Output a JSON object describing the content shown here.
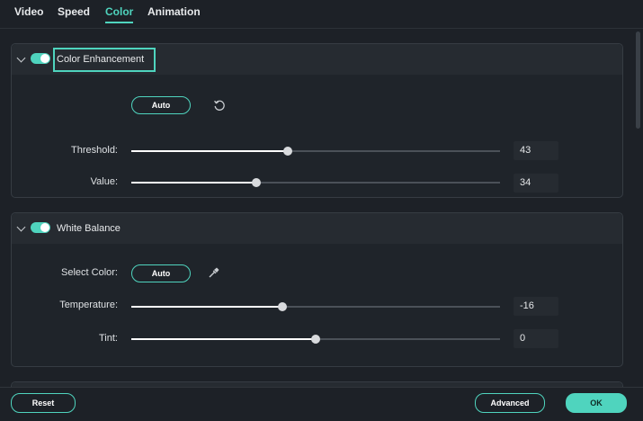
{
  "tabs": [
    {
      "label": "Video"
    },
    {
      "label": "Speed"
    },
    {
      "label": "Color"
    },
    {
      "label": "Animation"
    }
  ],
  "active_tab": "Color",
  "accent_color": "#4fd4be",
  "color_enhancement": {
    "title": "Color Enhancement",
    "enabled": true,
    "auto_label": "Auto",
    "reset_icon": "rotate-ccw-icon",
    "threshold": {
      "label": "Threshold:",
      "value": "43",
      "fraction": 0.425
    },
    "value": {
      "label": "Value:",
      "value": "34",
      "fraction": 0.34
    }
  },
  "white_balance": {
    "title": "White Balance",
    "enabled": true,
    "select_color_label": "Select Color:",
    "auto_label": "Auto",
    "picker_icon": "eyedropper-icon",
    "temperature": {
      "label": "Temperature:",
      "value": "-16",
      "fraction": 0.41
    },
    "tint": {
      "label": "Tint:",
      "value": "0",
      "fraction": 0.5
    }
  },
  "footer": {
    "reset_label": "Reset",
    "advanced_label": "Advanced",
    "ok_label": "OK"
  }
}
